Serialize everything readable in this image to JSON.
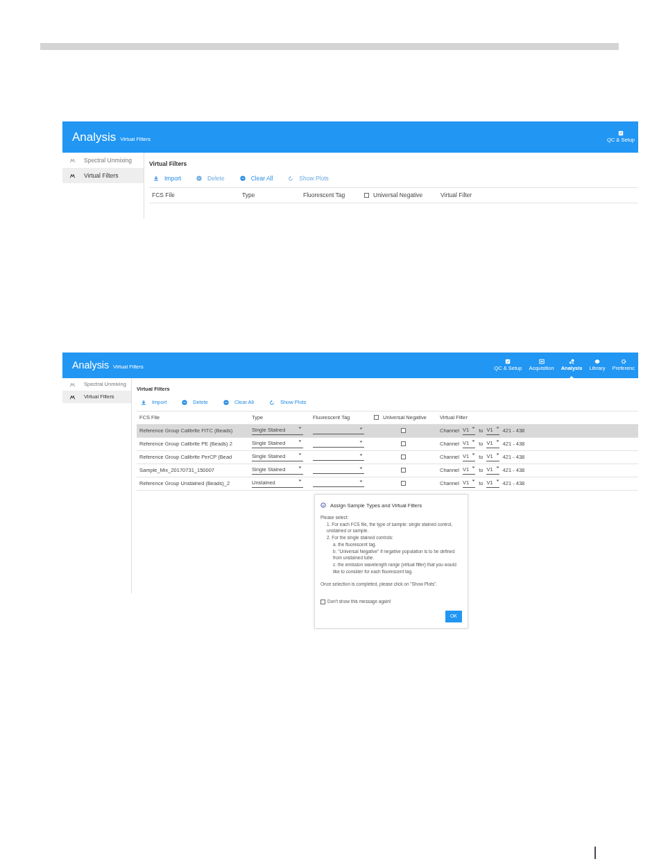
{
  "screens": [
    {
      "header": {
        "title": "Analysis",
        "subtitle": "Virtual Filters",
        "nav": [
          {
            "label": "QC & Setup",
            "selected": false
          }
        ]
      },
      "sidebar": {
        "items": [
          {
            "label": "Spectral Unmixing",
            "selected": false
          },
          {
            "label": "Virtual Filters",
            "selected": true
          }
        ]
      },
      "panel_title": "Virtual Filters",
      "toolbar": [
        {
          "label": "Import",
          "kind": "import",
          "disabled": false
        },
        {
          "label": "Delete",
          "kind": "delete",
          "disabled": true
        },
        {
          "label": "Clear All",
          "kind": "clear",
          "disabled": false
        },
        {
          "label": "Show Plots",
          "kind": "plots",
          "disabled": true
        }
      ],
      "table": {
        "columns": [
          "FCS File",
          "Type",
          "Fluorescent Tag",
          "Universal Negative",
          "Virtual Filter"
        ],
        "all_universal_negative": false
      }
    },
    {
      "header": {
        "title": "Analysis",
        "subtitle": "Virtual Filters",
        "nav": [
          {
            "label": "QC & Setup",
            "selected": false
          },
          {
            "label": "Acquisition",
            "selected": false
          },
          {
            "label": "Analysis",
            "selected": true
          },
          {
            "label": "Library",
            "selected": false
          },
          {
            "label": "Preferenc",
            "selected": false
          }
        ]
      },
      "sidebar": {
        "items": [
          {
            "label": "Spectral Unmixing",
            "selected": false
          },
          {
            "label": "Virtual Filters",
            "selected": true
          }
        ]
      },
      "panel_title": "Virtual Filters",
      "toolbar": [
        {
          "label": "Import",
          "kind": "import",
          "disabled": false
        },
        {
          "label": "Delete",
          "kind": "delete",
          "disabled": false
        },
        {
          "label": "Clear All",
          "kind": "clear",
          "disabled": false
        },
        {
          "label": "Show Plots",
          "kind": "plots",
          "disabled": false
        }
      ],
      "table": {
        "columns": [
          "FCS File",
          "Type",
          "Fluorescent Tag",
          "Universal Negative",
          "Virtual Filter"
        ],
        "all_universal_negative": false,
        "rows": [
          {
            "file": "Reference Group Calibrite FITC (Beads)",
            "type": "Single Stained",
            "universal_negative": false,
            "channel_label": "Channel",
            "from": "V1",
            "to_label": "to",
            "to": "V1",
            "range": "421 - 438",
            "selected": true
          },
          {
            "file": "Reference Group Calibrite PE (Beads) 2",
            "type": "Single Stained",
            "universal_negative": false,
            "channel_label": "Channel",
            "from": "V1",
            "to_label": "to",
            "to": "V1",
            "range": "421 - 438",
            "selected": false
          },
          {
            "file": "Reference Group Calibrite PerCP (Bead",
            "type": "Single Stained",
            "universal_negative": false,
            "channel_label": "Channel",
            "from": "V1",
            "to_label": "to",
            "to": "V1",
            "range": "421 - 438",
            "selected": false
          },
          {
            "file": "Sample_Mix_20170731_150007",
            "type": "Single Stained",
            "universal_negative": false,
            "channel_label": "Channel",
            "from": "V1",
            "to_label": "to",
            "to": "V1",
            "range": "421 - 438",
            "selected": false
          },
          {
            "file": "Reference Group Unstained (Beads)_2",
            "type": "Unstained",
            "universal_negative": false,
            "channel_label": "Channel",
            "from": "V1",
            "to_label": "to",
            "to": "V1",
            "range": "421 - 438",
            "selected": false
          }
        ]
      },
      "dialog": {
        "title": "Assign Sample Types and Virtual Filters",
        "lines": [
          {
            "text": "Please select:",
            "children": [
              {
                "text": "1. For each FCS file, the type of sample: single stained control, unstained or sample."
              },
              {
                "text": "2. For the single stained controls:",
                "children": [
                  {
                    "text": "a. the fluorescent tag."
                  },
                  {
                    "text": "b. \"Universal Negative\" if negative population is to be defined from unstained tube."
                  },
                  {
                    "text": "c. the emission wavelength range (virtual filter) that you would like to consider for each fluorescent tag."
                  }
                ]
              }
            ]
          },
          {
            "text": "Once selection is completed, please click on \"Show Plots\"."
          }
        ],
        "checkbox": {
          "label": "Don't show this message again!",
          "checked": false
        },
        "button": "OK"
      }
    }
  ]
}
